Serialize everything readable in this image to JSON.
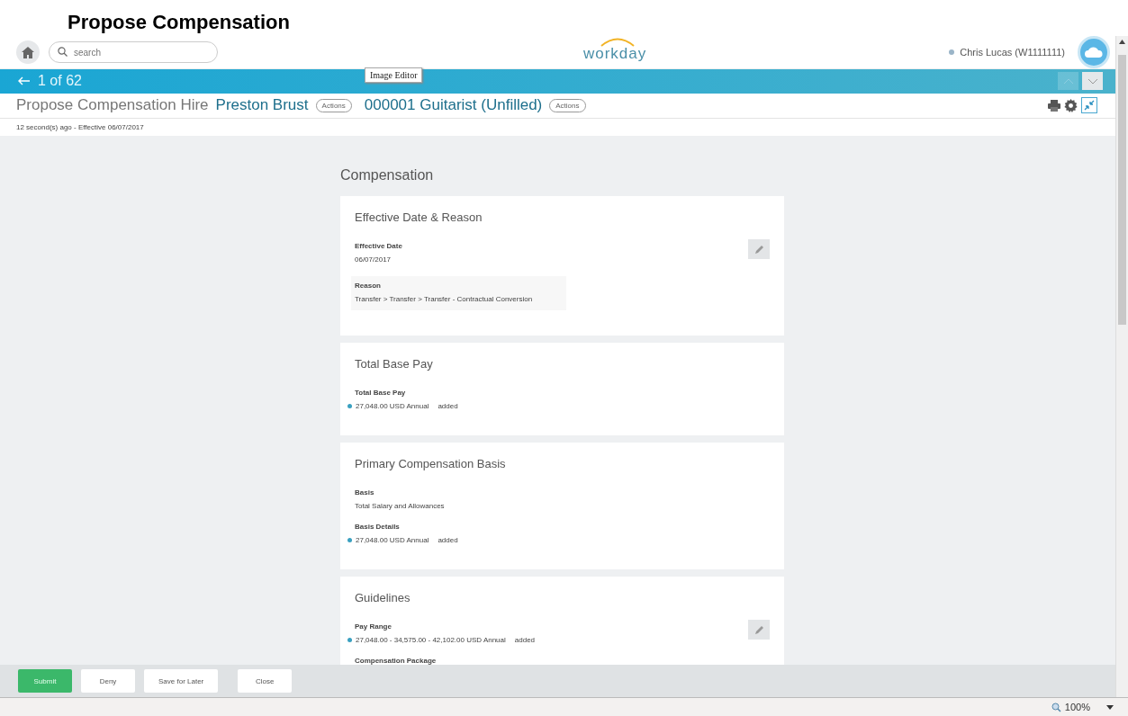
{
  "page_heading": "Propose Compensation",
  "top_bar": {
    "search": {
      "placeholder": "search"
    },
    "logo": "workday",
    "user": {
      "name": "Chris Lucas (W1111111)",
      "online": true
    }
  },
  "banner": {
    "counter": "1 of 62",
    "tooltip": "Image Editor",
    "prev_disabled": true,
    "next_disabled": false
  },
  "header": {
    "title": "Propose Compensation Hire",
    "worker": "Preston Brust",
    "worker_actions": "Actions",
    "position": "000001 Guitarist (Unfilled)",
    "position_actions": "Actions",
    "meta": "12 second(s) ago - Effective 06/07/2017"
  },
  "section_title": "Compensation",
  "cards": [
    {
      "title": "Effective Date & Reason",
      "editable": true,
      "fields": [
        {
          "label": "Effective Date",
          "value": "06/07/2017",
          "highlighted": false,
          "added": false
        },
        {
          "label": "Reason",
          "value": "Transfer > Transfer > Transfer - Contractual Conversion",
          "highlighted": true,
          "added": false
        }
      ]
    },
    {
      "title": "Total Base Pay",
      "editable": false,
      "fields": [
        {
          "label": "Total Base Pay",
          "value": "27,048.00 USD Annual",
          "status": "added",
          "highlighted": false,
          "added": true
        }
      ]
    },
    {
      "title": "Primary Compensation Basis",
      "editable": false,
      "fields": [
        {
          "label": "Basis",
          "value": "Total Salary and Allowances",
          "highlighted": false,
          "added": false
        },
        {
          "label": "Basis Details",
          "value": "27,048.00 USD Annual",
          "status": "added",
          "highlighted": false,
          "added": true
        }
      ]
    },
    {
      "title": "Guidelines",
      "editable": true,
      "fields": [
        {
          "label": "Pay Range",
          "value": "27,048.00 - 34,575.00 - 42,102.00 USD Annual",
          "status": "added",
          "highlighted": false,
          "added": true
        },
        {
          "label": "Compensation Package"
        }
      ]
    }
  ],
  "footer_buttons": [
    {
      "label": "Submit",
      "kind": "primary"
    },
    {
      "label": "Deny",
      "kind": "secondary"
    },
    {
      "label": "Save for Later",
      "kind": "secondary"
    },
    {
      "label": "Close",
      "kind": "secondary"
    }
  ],
  "status_bar": {
    "zoom": "100%"
  }
}
